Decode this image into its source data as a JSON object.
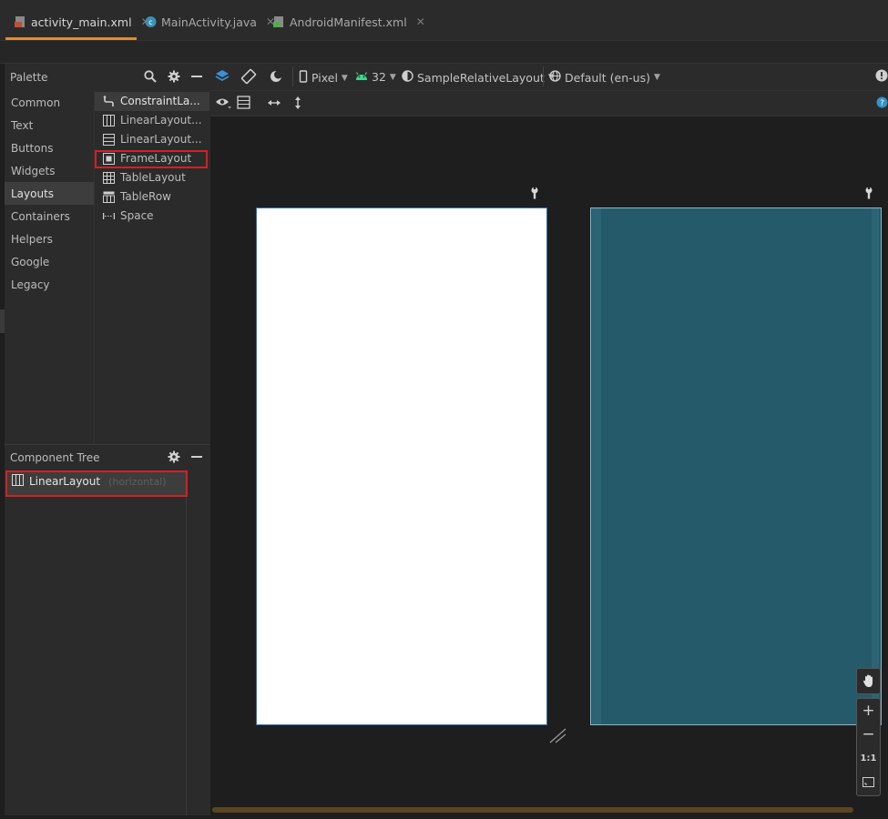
{
  "tabs": [
    {
      "label": "activity_main.xml",
      "icon": "layout-file-icon"
    },
    {
      "label": "MainActivity.java",
      "icon": "java-class-icon"
    },
    {
      "label": "AndroidManifest.xml",
      "icon": "manifest-file-icon"
    }
  ],
  "palette": {
    "title": "Palette",
    "categories": [
      "Common",
      "Text",
      "Buttons",
      "Widgets",
      "Layouts",
      "Containers",
      "Helpers",
      "Google",
      "Legacy"
    ],
    "selected_category": "Layouts",
    "items": [
      "ConstraintLa...",
      "LinearLayout...",
      "LinearLayout...",
      "FrameLayout",
      "TableLayout",
      "TableRow",
      "Space"
    ]
  },
  "component_tree": {
    "title": "Component Tree",
    "root": {
      "label": "LinearLayout",
      "orientation": "(horizontal)"
    }
  },
  "toolbar": {
    "device": "Pixel",
    "api": "32",
    "theme": "SampleRelativeLayout",
    "locale": "Default (en-us)"
  },
  "zoom": {
    "one_to_one": "1:1"
  },
  "colors": {
    "accent_tab": "#e38c2f",
    "highlight_box": "#d42020",
    "blueprint": "#255a6a",
    "android_green": "#3ddc84"
  }
}
